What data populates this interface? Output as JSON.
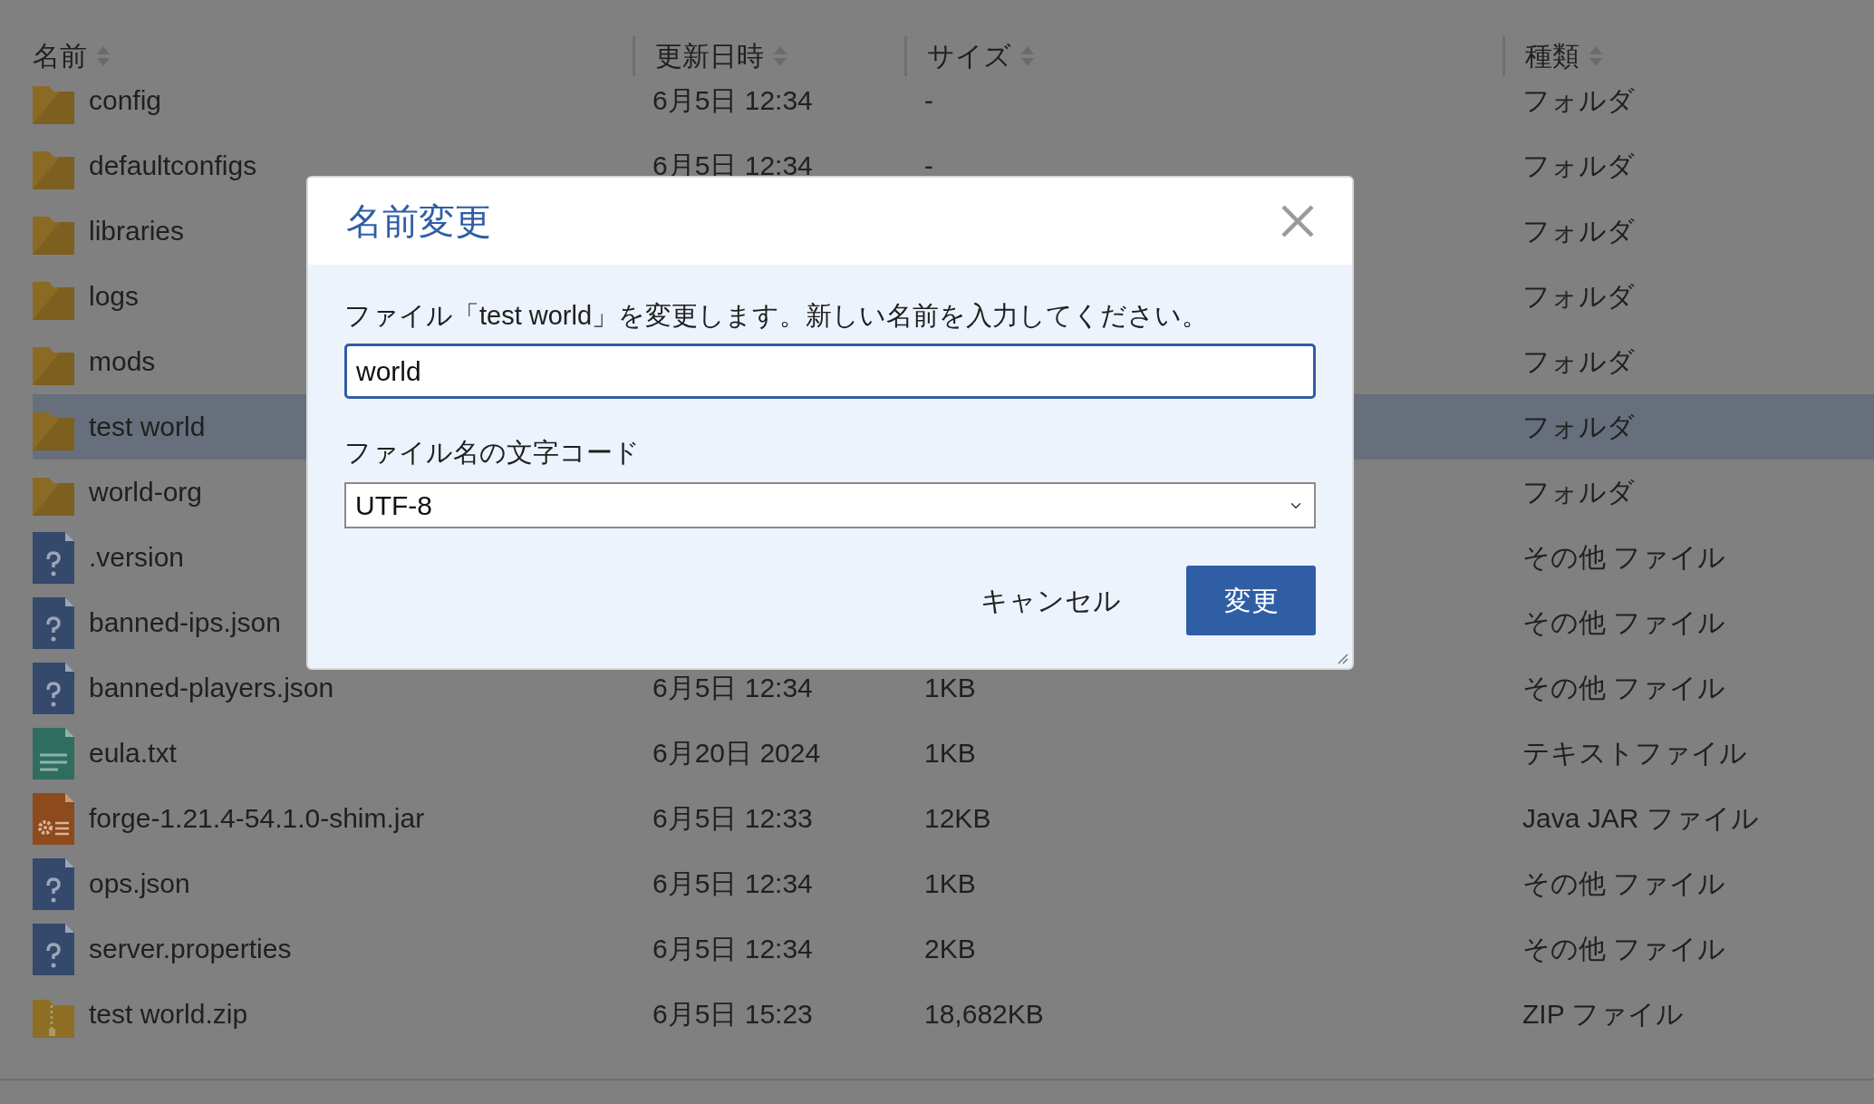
{
  "columns": [
    {
      "label": "名前",
      "sortable": true
    },
    {
      "label": "更新日時",
      "sortable": true
    },
    {
      "label": "サイズ",
      "sortable": true
    },
    {
      "label": "種類",
      "sortable": true
    }
  ],
  "rows": [
    {
      "kind": "folder",
      "name": "config",
      "modified": "6月5日 12:34",
      "size": "-",
      "type": "フォルダ",
      "selected": false
    },
    {
      "kind": "folder",
      "name": "defaultconfigs",
      "modified": "6月5日 12:34",
      "size": "-",
      "type": "フォルダ",
      "selected": false
    },
    {
      "kind": "folder",
      "name": "libraries",
      "type": "フォルダ",
      "selected": false
    },
    {
      "kind": "folder",
      "name": "logs",
      "type": "フォルダ",
      "selected": false
    },
    {
      "kind": "folder",
      "name": "mods",
      "type": "フォルダ",
      "selected": false
    },
    {
      "kind": "folder",
      "name": "test world",
      "type": "フォルダ",
      "selected": true
    },
    {
      "kind": "folder",
      "name": "world-org",
      "type": "フォルダ",
      "selected": false
    },
    {
      "kind": "unknown",
      "name": ".version",
      "type": "その他 ファイル",
      "selected": false
    },
    {
      "kind": "unknown",
      "name": "banned-ips.json",
      "type": "その他 ファイル",
      "selected": false
    },
    {
      "kind": "unknown",
      "name": "banned-players.json",
      "modified": "6月5日 12:34",
      "size": "1KB",
      "type": "その他 ファイル",
      "selected": false
    },
    {
      "kind": "text",
      "name": "eula.txt",
      "modified": "6月20日 2024",
      "size": "1KB",
      "type": "テキストファイル",
      "selected": false
    },
    {
      "kind": "jar",
      "name": "forge-1.21.4-54.1.0-shim.jar",
      "modified": "6月5日 12:33",
      "size": "12KB",
      "type": "Java JAR ファイル",
      "selected": false
    },
    {
      "kind": "unknown",
      "name": "ops.json",
      "modified": "6月5日 12:34",
      "size": "1KB",
      "type": "その他 ファイル",
      "selected": false
    },
    {
      "kind": "unknown",
      "name": "server.properties",
      "modified": "6月5日 12:34",
      "size": "2KB",
      "type": "その他 ファイル",
      "selected": false
    },
    {
      "kind": "zip",
      "name": "test world.zip",
      "modified": "6月5日 15:23",
      "size": "18,682KB",
      "type": "ZIP ファイル",
      "selected": false
    }
  ],
  "dialog": {
    "title": "名前変更",
    "message": "ファイル「test world」を変更します。新しい名前を入力してください。",
    "name_field": {
      "value": "world",
      "focused": true
    },
    "encoding_label": "ファイル名の文字コード",
    "encoding_select": {
      "value": "UTF-8"
    },
    "buttons": [
      {
        "label": "キャンセル",
        "kind": "link"
      },
      {
        "label": "変更",
        "kind": "primary"
      }
    ]
  }
}
